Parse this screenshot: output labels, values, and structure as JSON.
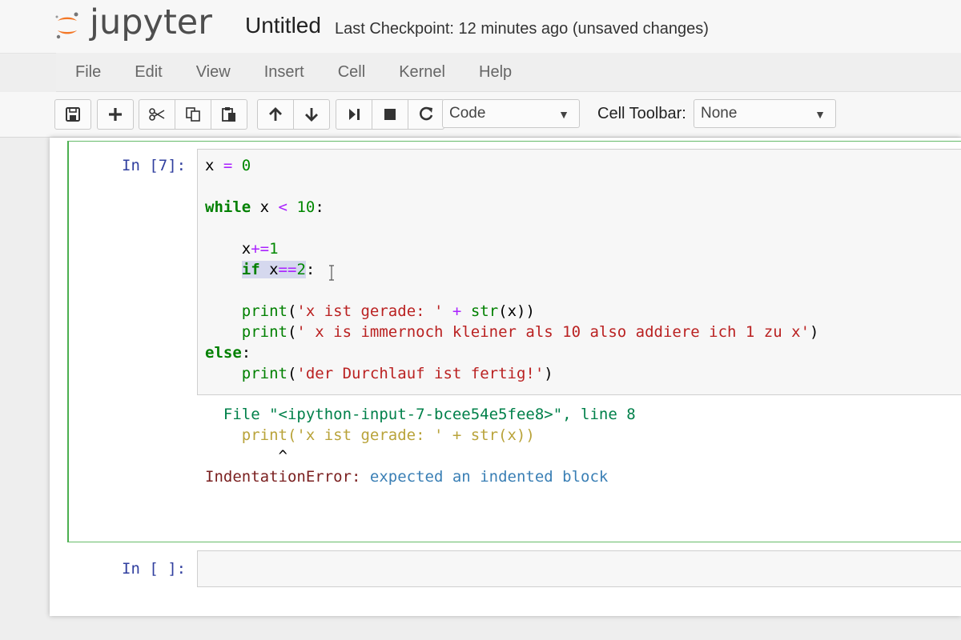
{
  "header": {
    "logo_text": "jupyter",
    "notebook_title": "Untitled",
    "checkpoint": "Last Checkpoint: 12 minutes ago (unsaved changes)"
  },
  "menu": {
    "items": [
      "File",
      "Edit",
      "View",
      "Insert",
      "Cell",
      "Kernel",
      "Help"
    ]
  },
  "toolbar": {
    "icons": [
      "save-icon",
      "plus-icon",
      "scissors-icon",
      "copy-icon",
      "paste-icon",
      "arrow-up-icon",
      "arrow-down-icon",
      "run-icon",
      "stop-icon",
      "restart-icon"
    ],
    "cell_type": "Code",
    "cell_toolbar_label": "Cell Toolbar:",
    "cell_toolbar_value": "None"
  },
  "cells": [
    {
      "prompt": "In [7]:",
      "code_lines": [
        "x = 0",
        "",
        "while x < 10:",
        "",
        "    x+=1",
        "    if x==2:",
        "",
        "    print('x ist gerade: ' + str(x))",
        "    print(' x is immernoch kleiner als 10 also addiere ich 1 zu x')",
        "else:",
        "    print('der Durchlauf ist fertig!')"
      ],
      "output": {
        "file_line": "File \"<ipython-input-7-bcee54e5fee8>\", line 8",
        "code_line": "print('x ist gerade: ' + str(x))",
        "caret": "^",
        "error_name": "IndentationError:",
        "error_message": "expected an indented block"
      }
    },
    {
      "prompt": "In [ ]:"
    }
  ],
  "colors": {
    "keyword": "#008000",
    "string": "#ba2121",
    "operator": "#aa22ff",
    "prompt": "#303f9f",
    "selected_cell_border": "#66bb6a"
  }
}
